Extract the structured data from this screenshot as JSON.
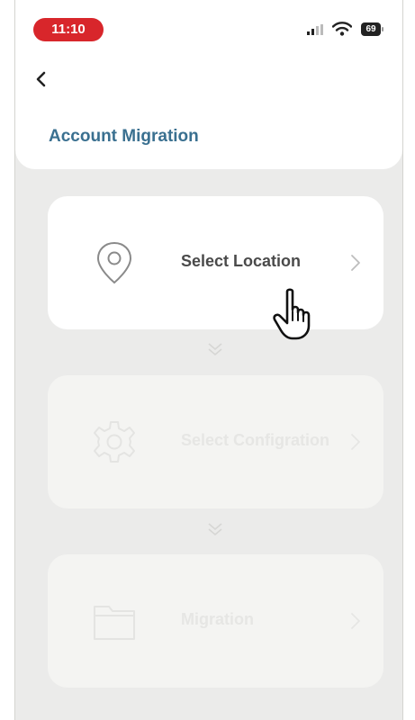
{
  "status_bar": {
    "time": "11:10",
    "battery": "69",
    "time_pill_color": "#d8262b"
  },
  "header": {
    "back_icon": "chevron-left-icon",
    "title": "Account Migration",
    "title_color": "#3a7090"
  },
  "steps": [
    {
      "label": "Select Location",
      "icon": "location-pin-icon",
      "state": "active"
    },
    {
      "label": "Select Configration",
      "icon": "gear-icon",
      "state": "disabled"
    },
    {
      "label": "Migration",
      "icon": "folder-icon",
      "state": "disabled"
    }
  ],
  "pointer": "hand-cursor-icon"
}
